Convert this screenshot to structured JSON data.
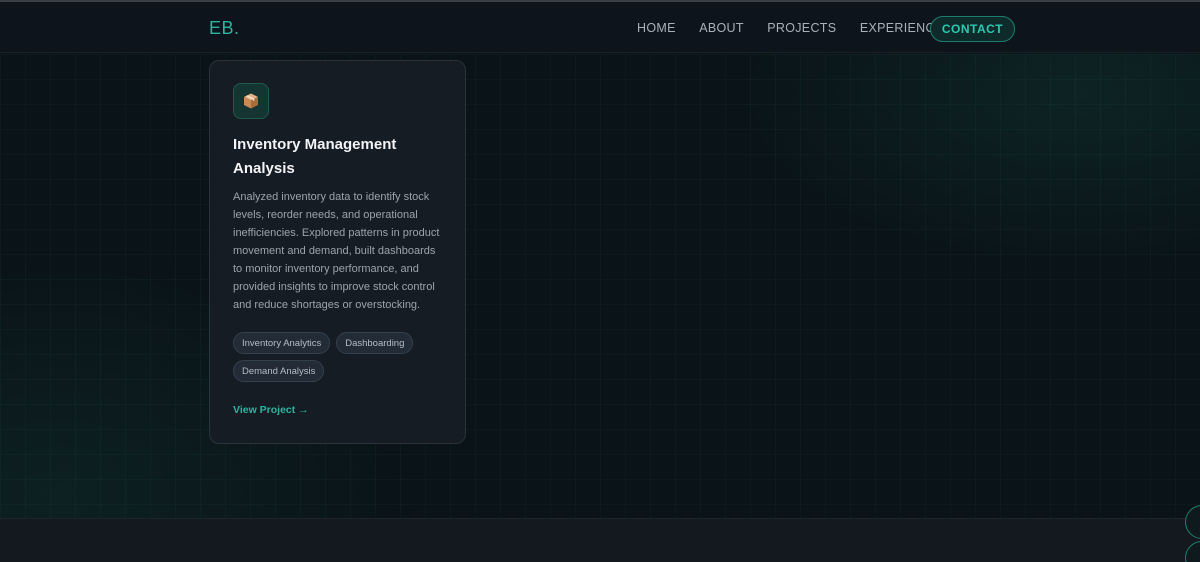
{
  "nav": {
    "brand": "EB.",
    "links": [
      "HOME",
      "ABOUT",
      "PROJECTS",
      "EXPERIENCE"
    ],
    "contact": "CONTACT"
  },
  "project": {
    "icon": "package-icon",
    "title": "Inventory Management Analysis",
    "description": "Analyzed inventory data to identify stock levels, reorder needs, and operational inefficiencies. Explored patterns in product movement and demand, built dashboards to monitor inventory performance, and provided insights to improve stock control and reduce shortages or overstocking.",
    "tags": [
      "Inventory Analytics",
      "Dashboarding",
      "Demand Analysis"
    ],
    "link_label": "View Project →"
  },
  "colors": {
    "accent": "#2bb5a0",
    "background": "#0d1218",
    "card": "#161c23"
  }
}
